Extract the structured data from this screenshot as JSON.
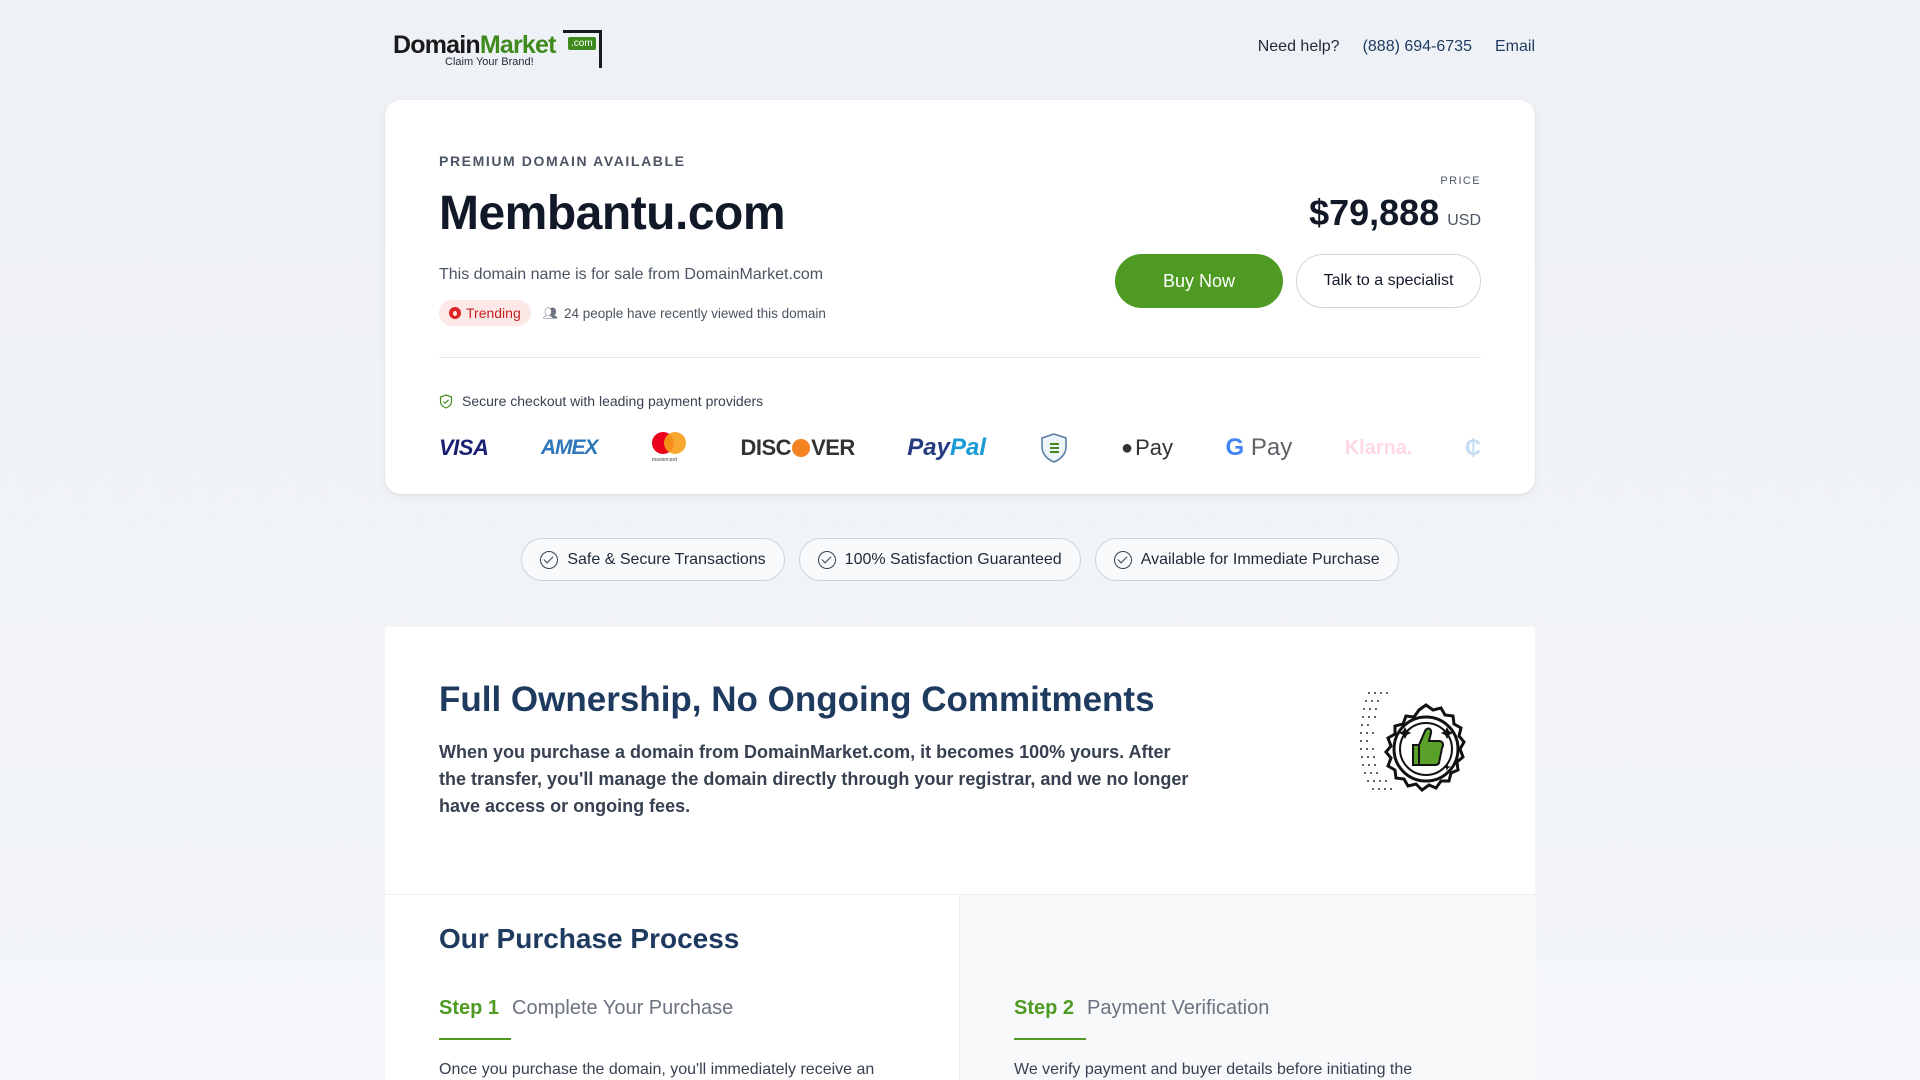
{
  "header": {
    "logo_main": "Domain",
    "logo_market": "Market",
    "logo_com": ".com",
    "logo_tagline": "Claim Your Brand!",
    "help_label": "Need help?",
    "phone": "(888) 694-6735",
    "email_label": "Email"
  },
  "listing": {
    "eyebrow": "PREMIUM DOMAIN AVAILABLE",
    "domain": "Membantu.com",
    "subline": "This domain name is for sale from DomainMarket.com",
    "trend_badge": "Trending",
    "viewers": "24 people have recently viewed this domain",
    "price_label": "PRICE",
    "price": "$79,888",
    "currency": "USD",
    "buy_label": "Buy Now",
    "talk_label": "Talk to a specialist",
    "secure_text": "Secure checkout with leading payment providers"
  },
  "payments": {
    "visa": "VISA",
    "amex": "AMEX",
    "mastercard_small": "mastercard",
    "discover_a": "DISC",
    "discover_b": "VER",
    "paypal_a": "Pay",
    "paypal_b": "Pal",
    "apple": "Pay",
    "gpay_g": "G",
    "gpay": "Pay",
    "klarna": "Klarna."
  },
  "chips": [
    "Safe & Secure Transactions",
    "100% Satisfaction Guaranteed",
    "Available for Immediate Purchase"
  ],
  "ownership": {
    "title": "Full Ownership, No Ongoing Commitments",
    "body": "When you purchase a domain from DomainMarket.com, it becomes 100% yours. After the transfer, you'll manage the domain directly through your registrar, and we no longer have access or ongoing fees."
  },
  "process": {
    "title": "Our Purchase Process",
    "step1_num": "Step 1",
    "step1_title": "Complete Your Purchase",
    "step1_text": "Once you purchase the domain, you'll immediately receive an",
    "step2_num": "Step 2",
    "step2_title": "Payment Verification",
    "step2_text": "We verify payment and buyer details before initiating the"
  },
  "colors": {
    "accent_green": "#4f9a22",
    "navy": "#1e3a5f",
    "trend_red": "#c81e1e"
  }
}
